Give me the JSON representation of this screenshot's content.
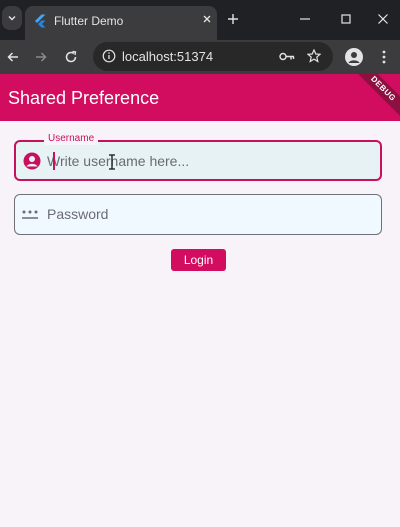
{
  "browser": {
    "tab_title": "Flutter Demo",
    "url": "localhost:51374"
  },
  "app": {
    "title": "Shared Preference",
    "debug_banner": "DEBUG",
    "accent_color": "#d20d60"
  },
  "form": {
    "username": {
      "label": "Username",
      "placeholder": "Write username here...",
      "value": "",
      "icon": "account-circle-icon"
    },
    "password": {
      "placeholder": "Password",
      "value": "",
      "icon": "password-dots-icon"
    },
    "login_label": "Login"
  }
}
